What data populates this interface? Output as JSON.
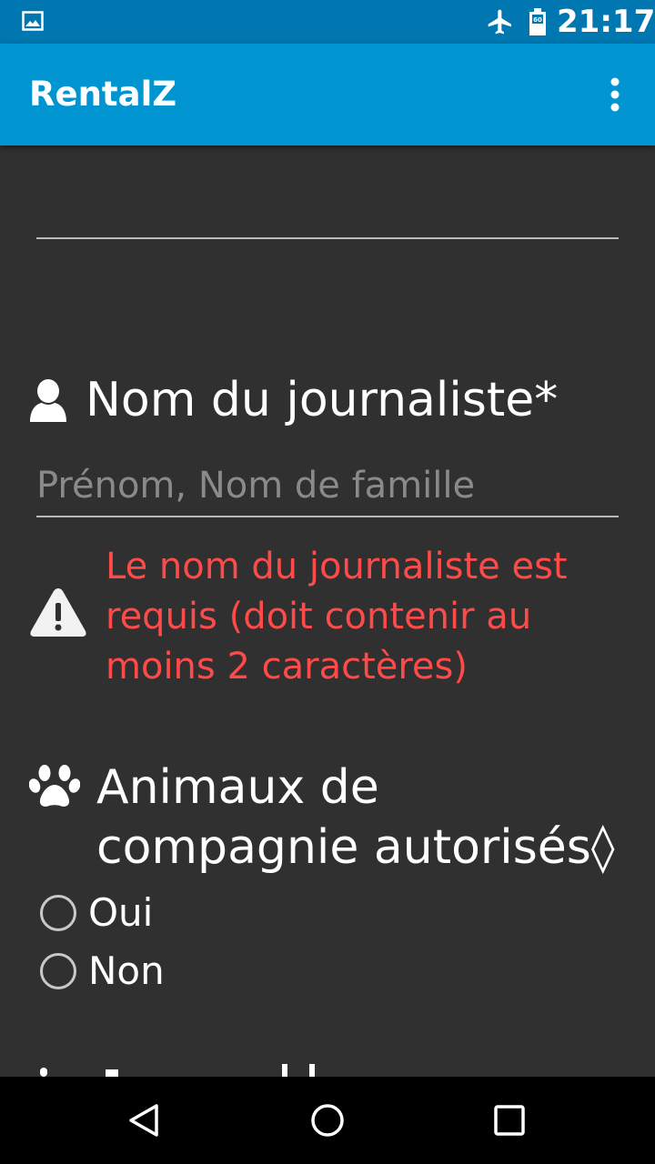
{
  "status_bar": {
    "time": "21:17",
    "icons": [
      "gallery-icon",
      "airplane-mode-icon",
      "battery-icon"
    ]
  },
  "app_bar": {
    "title": "RentalZ",
    "menu_icon": "more-vert-icon"
  },
  "form": {
    "journalist": {
      "icon": "user-icon",
      "label": "Nom du journaliste*",
      "input_value": "",
      "placeholder": "Prénom, Nom de famille",
      "error_icon": "warning-icon",
      "error_message": "Le nom du journaliste est requis (doit contenir au moins 2 caractères)"
    },
    "pets": {
      "icon": "paw-icon",
      "label_line1": "Animaux de",
      "label_line2": "compagnie autorisés◊",
      "options": [
        {
          "label": "Oui",
          "selected": false
        },
        {
          "label": "Non",
          "selected": false
        }
      ]
    }
  },
  "colors": {
    "status_bar": "#0077b0",
    "app_bar": "#0095d1",
    "background": "#303030",
    "error": "#ff4a4a"
  },
  "nav_bar": {
    "icons": [
      "back-icon",
      "home-icon",
      "recents-icon"
    ]
  }
}
